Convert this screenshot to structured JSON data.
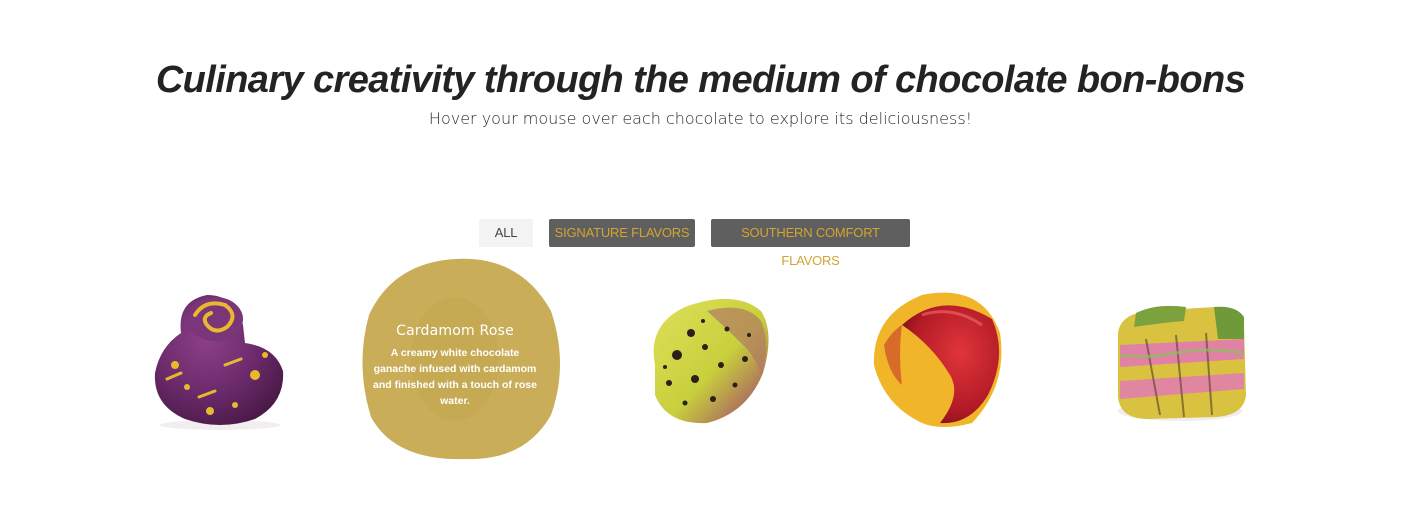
{
  "header": {
    "title": "Culinary creativity through the medium of chocolate bon-bons",
    "subtitle": "Hover your mouse over each chocolate to explore its deliciousness!"
  },
  "filters": {
    "items": [
      {
        "label": "ALL",
        "active": true
      },
      {
        "label": "SIGNATURE FLAVORS",
        "active": false
      },
      {
        "label": "SOUTHERN COMFORT FLAVORS",
        "active": false
      }
    ]
  },
  "gallery": {
    "hovered": {
      "name": "Cardamom Rose",
      "description": "A creamy white chocolate ganache infused with cardamom and finished with a touch of rose water."
    }
  },
  "colors": {
    "accent_gold": "#d2a431",
    "overlay_gold": "#c9ad58",
    "filter_bg": "#5f5f5f",
    "filter_all_bg": "#f3f3f3"
  }
}
